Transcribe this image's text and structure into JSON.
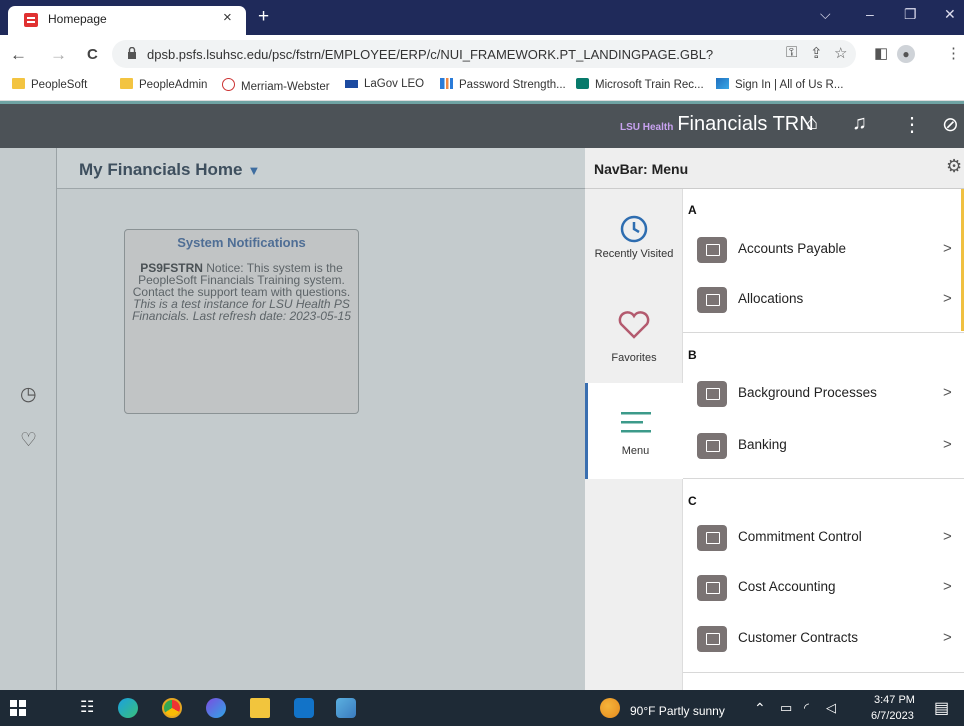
{
  "browser": {
    "tab_title": "Homepage",
    "tab_close": "×",
    "new_tab": "+",
    "url": "dpsb.psfs.lsuhsc.edu/psc/fstrn/EMPLOYEE/ERP/c/NUI_FRAMEWORK.PT_LANDINGPAGE.GBL?",
    "window_controls": [
      "⌵",
      "–",
      "❐",
      "✕"
    ],
    "nav": {
      "back": "←",
      "forward": "→",
      "reload": "C"
    }
  },
  "bookmarks": [
    {
      "label": "PeopleSoft",
      "icon": "folder-icon"
    },
    {
      "label": "PeopleAdmin",
      "icon": "folder-icon"
    },
    {
      "label": "Merriam-Webster",
      "icon": "merriam-webster-icon"
    },
    {
      "label": "LaGov LEO",
      "icon": "sap-icon"
    },
    {
      "label": "Password Strength...",
      "icon": "password-icon"
    },
    {
      "label": "Microsoft Train Rec...",
      "icon": "sharepoint-icon"
    },
    {
      "label": "Sign In | All of Us R...",
      "icon": "allofus-icon"
    }
  ],
  "header": {
    "brand_small": "LSU Health",
    "title": "Financials TRN",
    "icons": [
      "home-icon",
      "bell-icon",
      "kebab-icon",
      "navbar-icon"
    ]
  },
  "main": {
    "page_title": "My Financials Home",
    "page_title_caret": "▼",
    "tile": {
      "title": "System Notifications",
      "notice_bold": "PS9FSTRN",
      "notice_text": "Notice: This system is the PeopleSoft Financials Training system. Contact the support team with questions.",
      "notice_italic": "This is a test instance for LSU Health PS Financials. Last refresh date: 2023-05-15"
    }
  },
  "navbar": {
    "title": "NavBar: Menu",
    "tabs": [
      {
        "label": "Recently Visited",
        "icon": "clock-icon"
      },
      {
        "label": "Favorites",
        "icon": "heart-icon"
      },
      {
        "label": "Menu",
        "icon": "menu-icon",
        "active": true
      }
    ],
    "sections": [
      {
        "letter": "A",
        "items": [
          "Accounts Payable",
          "Allocations"
        ]
      },
      {
        "letter": "B",
        "items": [
          "Background Processes",
          "Banking"
        ]
      },
      {
        "letter": "C",
        "items": [
          "Commitment Control",
          "Cost Accounting",
          "Customer Contracts"
        ]
      }
    ],
    "chevron": ">"
  },
  "taskbar": {
    "weather": "90°F  Partly sunny",
    "time": "3:47 PM",
    "date": "6/7/2023"
  }
}
